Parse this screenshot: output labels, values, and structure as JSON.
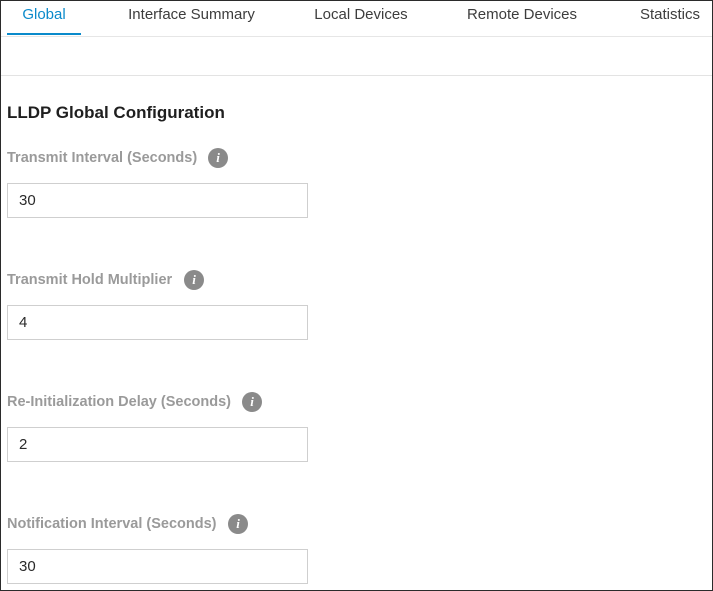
{
  "tabs": [
    {
      "label": "Global",
      "active": true
    },
    {
      "label": "Interface Summary",
      "active": false
    },
    {
      "label": "Local Devices",
      "active": false
    },
    {
      "label": "Remote Devices",
      "active": false
    },
    {
      "label": "Statistics",
      "active": false
    }
  ],
  "section": {
    "title": "LLDP Global Configuration"
  },
  "fields": [
    {
      "label": "Transmit Interval (Seconds)",
      "value": "30",
      "info_icon": "info-icon"
    },
    {
      "label": "Transmit Hold Multiplier",
      "value": "4",
      "info_icon": "info-icon"
    },
    {
      "label": "Re-Initialization Delay (Seconds)",
      "value": "2",
      "info_icon": "info-icon"
    },
    {
      "label": "Notification Interval (Seconds)",
      "value": "30",
      "info_icon": "info-icon"
    }
  ],
  "info_glyph": "i",
  "colors": {
    "accent": "#0a8acb",
    "label_gray": "#9a9a9a",
    "info_icon_bg": "#8a8a8a",
    "input_border": "#cfcfcf"
  }
}
